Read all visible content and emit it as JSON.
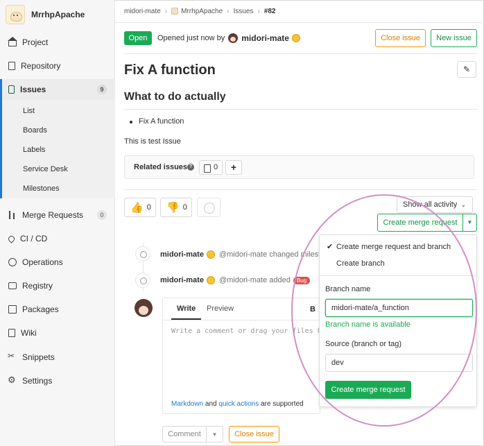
{
  "sidebar": {
    "project_name": "MrrhpApache",
    "items": [
      {
        "label": "Project"
      },
      {
        "label": "Repository"
      },
      {
        "label": "Issues",
        "count": "9"
      },
      {
        "label": "Merge Requests",
        "count": "0"
      },
      {
        "label": "CI / CD"
      },
      {
        "label": "Operations"
      },
      {
        "label": "Registry"
      },
      {
        "label": "Packages"
      },
      {
        "label": "Wiki"
      },
      {
        "label": "Snippets"
      },
      {
        "label": "Settings"
      }
    ],
    "issues_sub": [
      "List",
      "Boards",
      "Labels",
      "Service Desk",
      "Milestones"
    ]
  },
  "breadcrumb": {
    "group": "midori-mate",
    "project": "MrrhpApache",
    "section": "Issues",
    "current": "#82"
  },
  "issue": {
    "status": "Open",
    "opened_text": "Opened just now by",
    "author": "midori-mate",
    "title": "Fix A function",
    "heading": "What to do actually",
    "bullet": "Fix A function",
    "paragraph": "This is test Issue"
  },
  "header_buttons": {
    "close": "Close issue",
    "new": "New issue"
  },
  "related": {
    "label": "Related issues",
    "count": "0",
    "add": "+"
  },
  "awards": [
    {
      "emoji": "👍",
      "count": "0"
    },
    {
      "emoji": "👎",
      "count": "0"
    }
  ],
  "activity": {
    "show_all": "Show all activity",
    "create_mr": "Create merge request",
    "notes": [
      {
        "author": "midori-mate",
        "text": "@midori-mate changed milest"
      },
      {
        "author": "midori-mate",
        "text": "@midori-mate added",
        "label": "Bug"
      }
    ]
  },
  "comment": {
    "tab_write": "Write",
    "tab_preview": "Preview",
    "bold": "B",
    "placeholder": "Write a comment or drag your files h",
    "footer_link1": "Markdown",
    "footer_and": "and",
    "footer_link2": "quick actions",
    "footer_rest": "are supported",
    "submit": "Comment",
    "close": "Close issue"
  },
  "mr_dropdown": {
    "option1": "Create merge request and branch",
    "option2": "Create branch",
    "branch_label": "Branch name",
    "branch_value": "midori-mate/a_function",
    "branch_status": "Branch name is available",
    "source_label": "Source (branch or tag)",
    "source_value": "dev",
    "submit": "Create merge request"
  },
  "colors": {
    "accent": "#1aaa55",
    "warning": "#fc9403",
    "annotation": "#d08ec8"
  }
}
